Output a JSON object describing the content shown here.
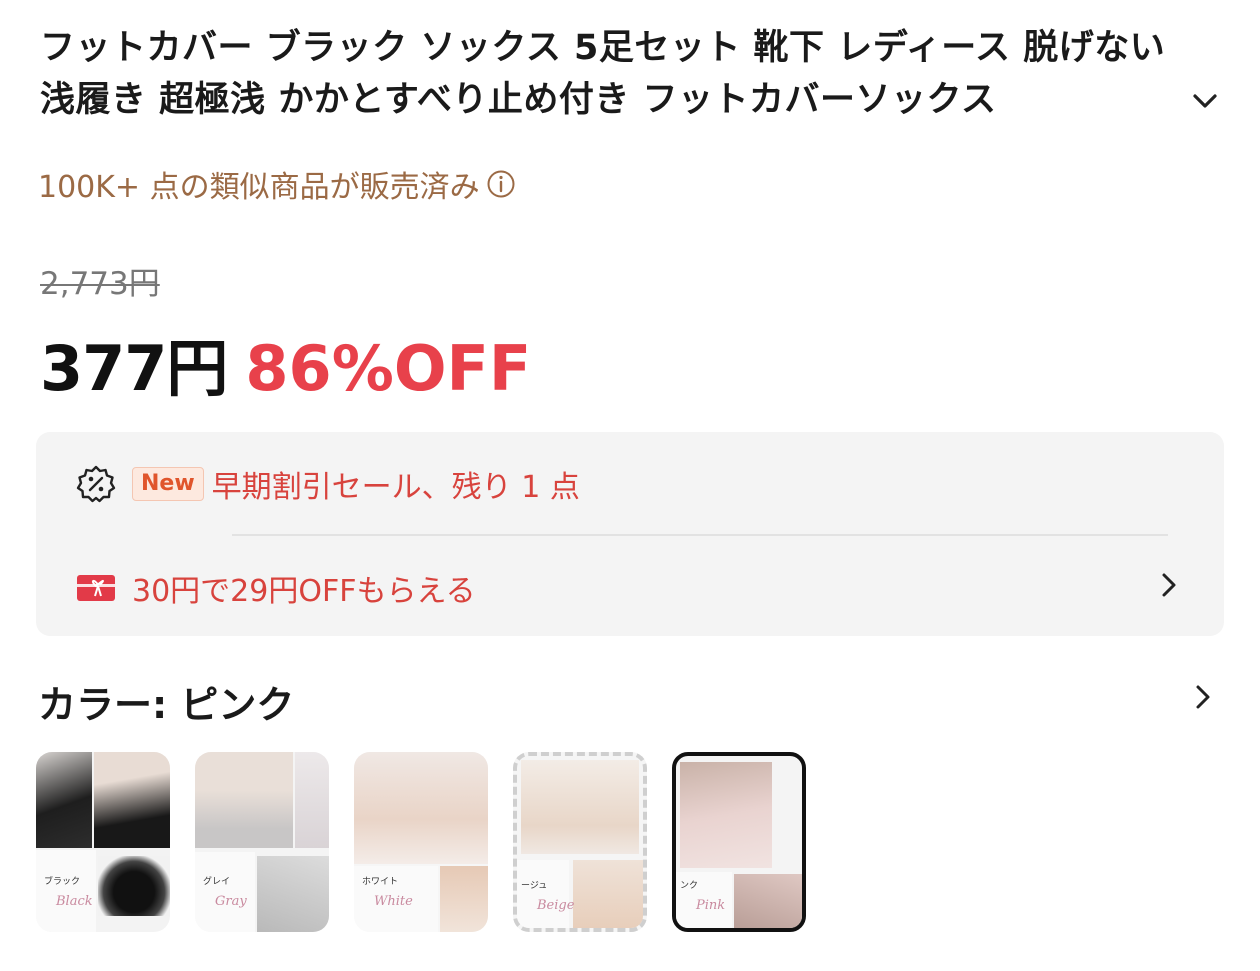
{
  "product": {
    "title": "フットカバー ブラック ソックス 5足セット 靴下 レディース 脱げない 浅履き 超極浅 かかとすべり止め付き フットカバーソックス",
    "sold_text": "100K+ 点の類似商品が販売済み",
    "original_price": "2,773円",
    "price": "377円",
    "discount": "86%OFF"
  },
  "promotions": {
    "badge": "New",
    "early_sale": "早期割引セール、残り 1 点",
    "coupon": "30円で29円OFFもらえる"
  },
  "color": {
    "label": "カラー: ピンク",
    "options": [
      {
        "label": "ブラック",
        "script": "Black",
        "state": "normal"
      },
      {
        "label": "グレイ",
        "script": "Gray",
        "state": "normal"
      },
      {
        "label": "ホワイト",
        "script": "White",
        "state": "normal"
      },
      {
        "label": "ージュ",
        "script": "Beige",
        "state": "dashed"
      },
      {
        "label": "ンク",
        "script": "Pink",
        "state": "selected"
      }
    ]
  },
  "icons": {
    "expand": "chevron-down-icon",
    "info": "info-icon",
    "discount": "percent-badge-icon",
    "coupon": "coupon-icon",
    "promo_more": "chevron-right-icon",
    "color_more": "chevron-right-icon"
  },
  "colors": {
    "accent_red": "#e8414b",
    "sold_brown": "#9b6a45",
    "promo_bg": "#f4f4f4"
  }
}
